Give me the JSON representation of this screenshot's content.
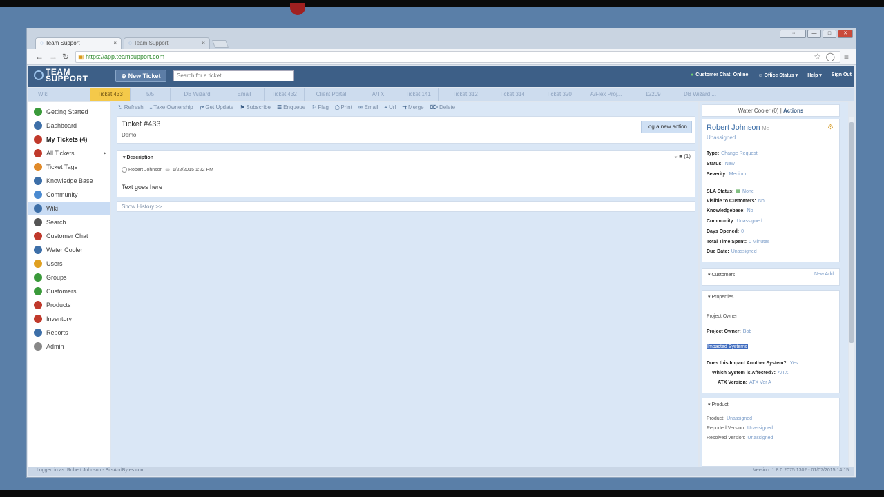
{
  "browser": {
    "tabs": [
      {
        "label": "Team Support",
        "active": true
      },
      {
        "label": "Team Support",
        "active": false
      }
    ],
    "url": "https://app.teamsupport.com",
    "window_buttons": [
      "···",
      "—",
      "□",
      "✕"
    ]
  },
  "app": {
    "logo_line1": "TEAM",
    "logo_line2": "SUPPORT",
    "new_ticket_label": "New Ticket",
    "search_placeholder": "Search for a ticket...",
    "header_links": [
      "Customer Chat: Online",
      "Office Status ▾",
      "Help ▾",
      "Sign Out"
    ]
  },
  "ticket_tabs": [
    "Wiki",
    "Ticket 433",
    "5/5",
    "DB Wizard",
    "Email",
    "Ticket 432",
    "Client Portal",
    "A/TX",
    "Ticket 141",
    "Ticket 312",
    "Ticket 314",
    "Ticket 320",
    "A/Flex Proj...",
    "12209",
    "DB Wizard ..."
  ],
  "sidebar": [
    {
      "label": "Getting Started",
      "icon": "getting-started-icon",
      "color": "#3a9a3a"
    },
    {
      "label": "Dashboard",
      "icon": "dashboard-icon",
      "color": "#3d6fa8"
    },
    {
      "label": "My Tickets (4)",
      "icon": "my-tickets-icon",
      "color": "#c0392b",
      "bold": true
    },
    {
      "label": "All Tickets",
      "icon": "all-tickets-icon",
      "color": "#c0392b",
      "arrow": "▸"
    },
    {
      "label": "Ticket Tags",
      "icon": "tag-icon",
      "color": "#e08a2a"
    },
    {
      "label": "Knowledge Base",
      "icon": "knowledge-base-icon",
      "color": "#3d6fa8"
    },
    {
      "label": "Community",
      "icon": "community-icon",
      "color": "#4a8ad0"
    },
    {
      "label": "Wiki",
      "icon": "wiki-icon",
      "color": "#3d6fa8",
      "selected": true
    },
    {
      "label": "Search",
      "icon": "search-icon",
      "color": "#555555"
    },
    {
      "label": "Customer Chat",
      "icon": "chat-icon",
      "color": "#c0392b"
    },
    {
      "label": "Water Cooler",
      "icon": "water-cooler-icon",
      "color": "#3d6fa8"
    },
    {
      "label": "Users",
      "icon": "users-icon",
      "color": "#e0a020"
    },
    {
      "label": "Groups",
      "icon": "groups-icon",
      "color": "#3a9a3a"
    },
    {
      "label": "Customers",
      "icon": "customers-icon",
      "color": "#3a9a3a"
    },
    {
      "label": "Products",
      "icon": "products-icon",
      "color": "#c0392b"
    },
    {
      "label": "Inventory",
      "icon": "inventory-icon",
      "color": "#c0392b"
    },
    {
      "label": "Reports",
      "icon": "reports-icon",
      "color": "#3d6fa8"
    },
    {
      "label": "Admin",
      "icon": "admin-icon",
      "color": "#888888"
    }
  ],
  "toolbar": [
    "Refresh",
    "Take Ownership",
    "Get Update",
    "Subscribe",
    "Enqueue",
    "Flag",
    "Print",
    "Email",
    "Url",
    "Merge",
    "Delete"
  ],
  "toolbar_icons": [
    "↻",
    "⤓",
    "⇄",
    "⚑",
    "☰",
    "⚐",
    "⎙",
    "✉",
    "⌖",
    "⇉",
    "⌦"
  ],
  "ticket": {
    "title": "Ticket #433",
    "subtitle": "Demo",
    "log_action_label": "Log a new action",
    "description_header": "▾ Description",
    "author": "Robert Johnson",
    "date": "1/22/2015 1:22 PM",
    "text": "Text goes here",
    "show_history": "Show History >>",
    "icons_text": "◒ ■  (1)"
  },
  "right": {
    "header": "Water Cooler (0) |",
    "header_link": "Actions",
    "person_name": "Robert Johnson",
    "person_tag": "Me",
    "assigned": "Unassigned",
    "fields_top": [
      {
        "k": "Type:",
        "v": "Change Request"
      },
      {
        "k": "Status:",
        "v": "New"
      },
      {
        "k": "Severity:",
        "v": "Medium"
      }
    ],
    "fields_sla": [
      {
        "k": "SLA Status:",
        "v": "None"
      },
      {
        "k": "Visible to Customers:",
        "v": "No"
      },
      {
        "k": "Knowledgebase:",
        "v": "No"
      },
      {
        "k": "Community:",
        "v": "Unassigned"
      },
      {
        "k": "Days Opened:",
        "v": "0"
      },
      {
        "k": "Total Time Spent:",
        "v": "0 Minutes"
      },
      {
        "k": "Due Date:",
        "v": "Unassigned"
      }
    ],
    "customers_header": "▾ Customers",
    "customers_actions": "New   Add",
    "properties_header": "▾ Properties",
    "project_owner_label": "Project Owner",
    "project_owner": {
      "k": "Project Owner:",
      "v": "Bob"
    },
    "impacted_systems": "Impacted Systems",
    "impact_q": {
      "k": "Does this Impact Another System?:",
      "v": "Yes"
    },
    "which_system": {
      "k": "Which System is Affected?:",
      "v": "A/TX"
    },
    "atx_version": {
      "k": "ATX Version:",
      "v": "ATX Ver A"
    },
    "product_header": "▾ Product",
    "product": {
      "k": "Product:",
      "v": "Unassigned"
    },
    "reported_version": {
      "k": "Reported Version:",
      "v": "Unassigned"
    },
    "resolved_version": {
      "k": "Resolved Version:",
      "v": "Unassigned"
    }
  },
  "status": {
    "left": "Logged in as: Robert Johnson - BitsAndBytes.com",
    "right": "Version: 1.8.0.2075.1302 - 01/07/2015 14:15"
  }
}
